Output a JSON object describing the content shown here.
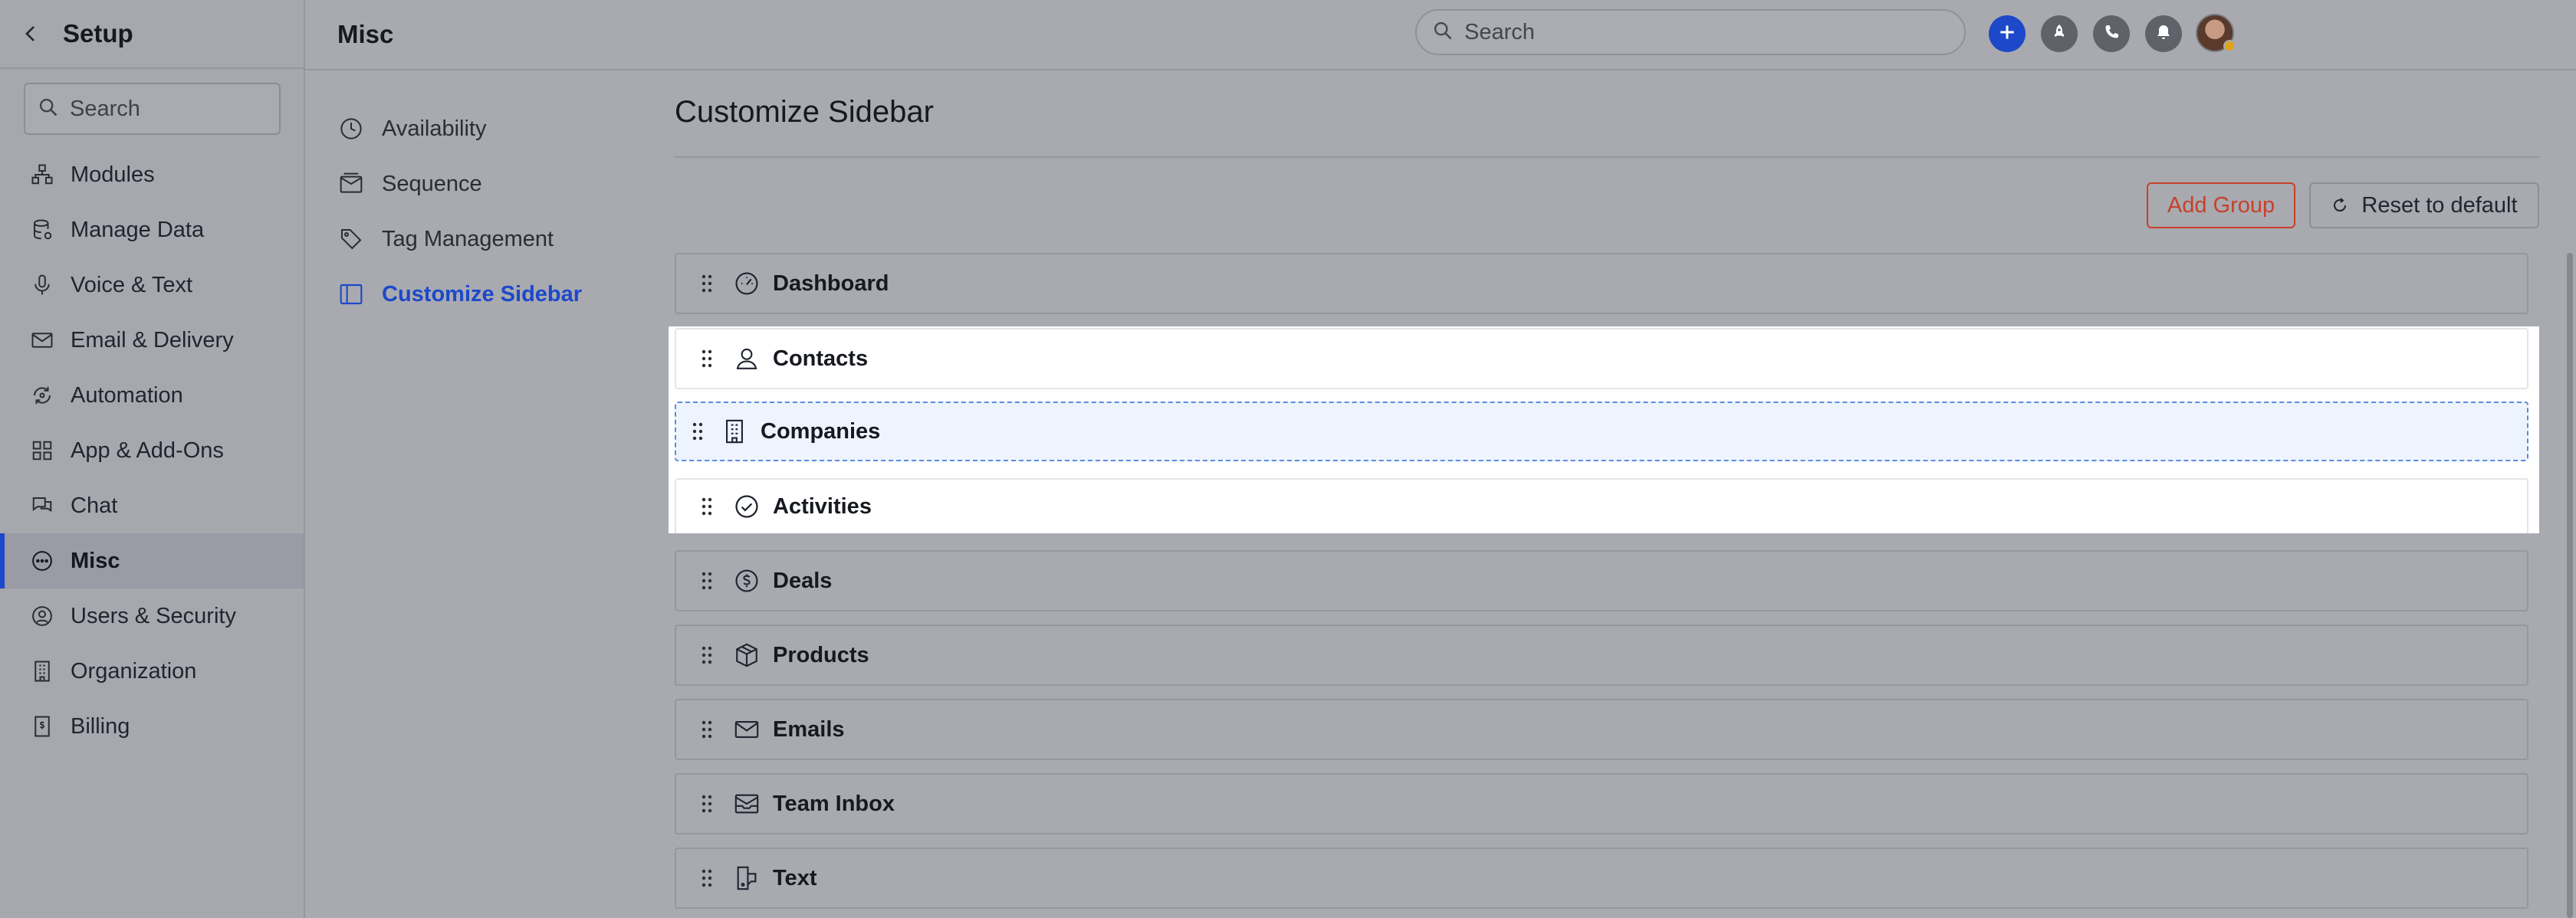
{
  "setup": {
    "title": "Setup",
    "search_placeholder": "Search",
    "nav": [
      {
        "label": "Modules",
        "icon": "modules-icon"
      },
      {
        "label": "Manage Data",
        "icon": "database-icon"
      },
      {
        "label": "Voice & Text",
        "icon": "microphone-icon"
      },
      {
        "label": "Email & Delivery",
        "icon": "envelope-icon"
      },
      {
        "label": "Automation",
        "icon": "automation-icon"
      },
      {
        "label": "App & Add-Ons",
        "icon": "apps-icon"
      },
      {
        "label": "Chat",
        "icon": "chat-icon"
      },
      {
        "label": "Misc",
        "icon": "more-circle-icon",
        "active": true
      },
      {
        "label": "Users & Security",
        "icon": "user-circle-icon"
      },
      {
        "label": "Organization",
        "icon": "building-icon"
      },
      {
        "label": "Billing",
        "icon": "receipt-icon"
      }
    ]
  },
  "header": {
    "title": "Misc",
    "search_placeholder": "Search"
  },
  "subnav": [
    {
      "label": "Availability",
      "icon": "clock-icon"
    },
    {
      "label": "Sequence",
      "icon": "sequence-icon"
    },
    {
      "label": "Tag Management",
      "icon": "tag-icon"
    },
    {
      "label": "Customize Sidebar",
      "icon": "sidebar-icon",
      "active": true
    }
  ],
  "main": {
    "title": "Customize Sidebar",
    "add_group_label": "Add Group",
    "reset_label": "Reset to default",
    "items": [
      {
        "label": "Dashboard",
        "icon": "gauge-icon"
      },
      {
        "label": "Contacts",
        "icon": "person-icon"
      },
      {
        "label": "Companies",
        "icon": "building-icon"
      },
      {
        "label": "Activities",
        "icon": "check-circle-icon"
      },
      {
        "label": "Deals",
        "icon": "dollar-circle-icon"
      },
      {
        "label": "Products",
        "icon": "box-icon"
      },
      {
        "label": "Emails",
        "icon": "envelope-icon"
      },
      {
        "label": "Team Inbox",
        "icon": "inbox-icon"
      },
      {
        "label": "Text",
        "icon": "text-message-icon"
      }
    ]
  },
  "colors": {
    "accent": "#1d48c9",
    "danger": "#c8402a",
    "overlay_bg": "#a8aab0"
  }
}
